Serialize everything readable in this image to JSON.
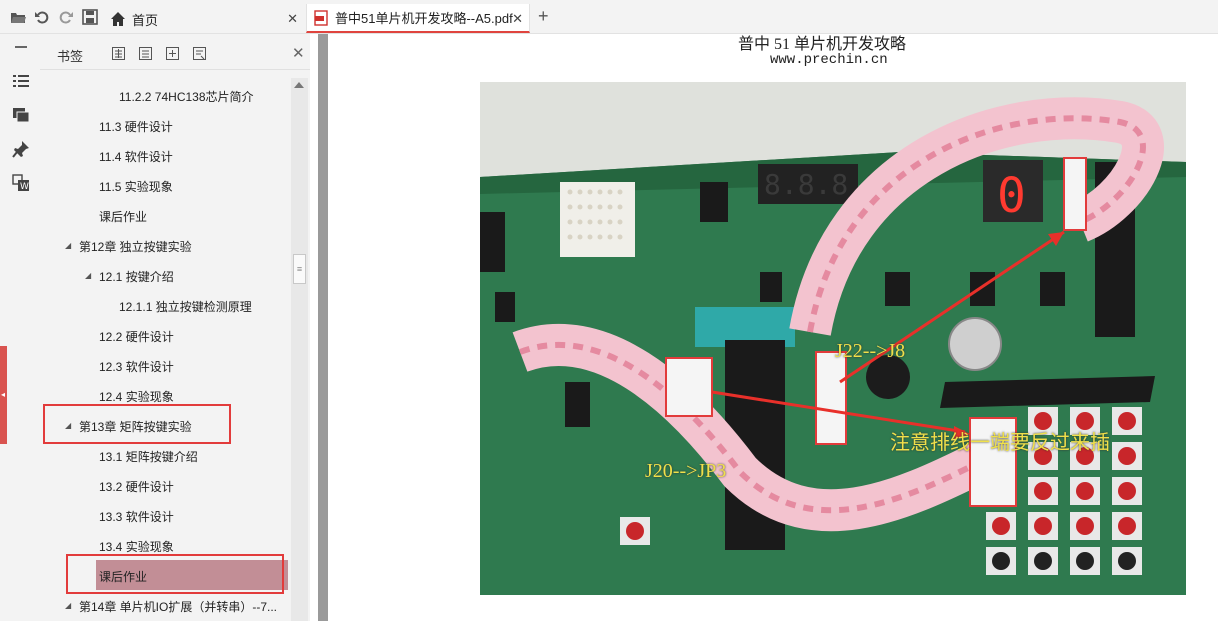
{
  "toolbar": {
    "icons": [
      "open-folder-icon",
      "undo-icon",
      "redo-icon",
      "save-icon"
    ]
  },
  "tabs": [
    {
      "label": "首页",
      "icon": "home-icon",
      "active": false
    },
    {
      "label": "普中51单片机开发攻略--A5.pdf",
      "icon": "pdf-icon",
      "active": true
    }
  ],
  "rail": {
    "icons": [
      "minus-icon",
      "outline-list-icon",
      "comments-icon",
      "stamp-icon",
      "convert-word-icon"
    ],
    "collapse_glyph": "◂"
  },
  "panel": {
    "title": "书签",
    "tool_icons": [
      "expand-all-icon",
      "collapse-all-icon",
      "add-bookmark-icon",
      "bookmark-properties-icon"
    ],
    "close_glyph": "✕",
    "scroll_thumb_glyph": "≡"
  },
  "bookmarks": [
    {
      "label": "11.2.2 74HC138芯片简介",
      "level": 3,
      "arrow": ""
    },
    {
      "label": "11.3 硬件设计",
      "level": 2,
      "arrow": ""
    },
    {
      "label": "11.4 软件设计",
      "level": 2,
      "arrow": ""
    },
    {
      "label": "11.5 实验现象",
      "level": 2,
      "arrow": ""
    },
    {
      "label": "课后作业",
      "level": 2,
      "arrow": ""
    },
    {
      "label": "第12章 独立按键实验",
      "level": 1,
      "arrow": "◢"
    },
    {
      "label": "12.1 按键介绍",
      "level": 2,
      "arrow": "◢"
    },
    {
      "label": "12.1.1 独立按键检测原理",
      "level": 3,
      "arrow": ""
    },
    {
      "label": "12.2 硬件设计",
      "level": 2,
      "arrow": ""
    },
    {
      "label": "12.3 软件设计",
      "level": 2,
      "arrow": ""
    },
    {
      "label": "12.4 实验现象",
      "level": 2,
      "arrow": ""
    },
    {
      "label": "第13章 矩阵按键实验",
      "level": 1,
      "arrow": "◢",
      "highlight": true
    },
    {
      "label": "13.1 矩阵按键介绍",
      "level": 2,
      "arrow": ""
    },
    {
      "label": "13.2 硬件设计",
      "level": 2,
      "arrow": ""
    },
    {
      "label": "13.3 软件设计",
      "level": 2,
      "arrow": ""
    },
    {
      "label": "13.4 实验现象",
      "level": 2,
      "arrow": ""
    },
    {
      "label": "课后作业",
      "level": 2,
      "arrow": "",
      "selected": true,
      "highlight": true
    },
    {
      "label": "第14章 单片机IO扩展（并转串）--7...",
      "level": 1,
      "arrow": "◢"
    }
  ],
  "document": {
    "header_title": "普中 51 单片机开发攻略",
    "header_url": "www.prechin.cn",
    "photo_annotations": [
      "J22-->J8",
      "注意排线一端要反过来插",
      "J20-->JP3"
    ],
    "seven_segment_digit": "0",
    "four_digit_display": "8.8.8.8."
  },
  "colors": {
    "accent": "#e0443e",
    "highlight_box": "#e23b3b",
    "selected_row": "#c28e96",
    "annotation_text": "#f0e04a",
    "pcb_green": "#2f7a4f"
  }
}
